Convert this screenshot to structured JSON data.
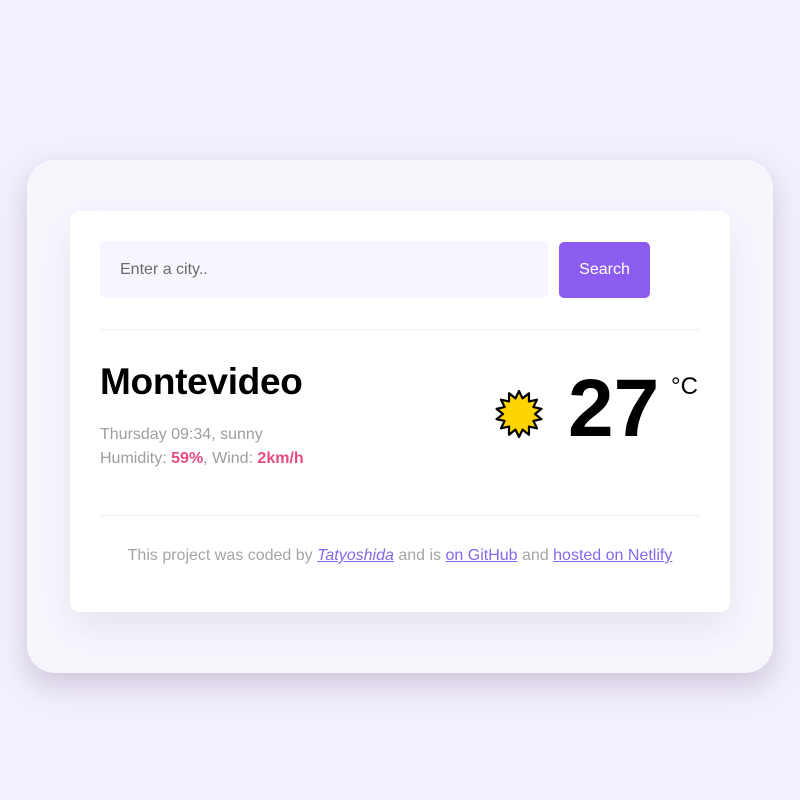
{
  "search": {
    "placeholder": "Enter a city..",
    "value": "",
    "button_label": "Search"
  },
  "weather": {
    "city": "Montevideo",
    "day_time": "Thursday 09:34",
    "condition": "sunny",
    "humidity_label": "Humidity:",
    "humidity_value": "59%",
    "wind_label": "Wind:",
    "wind_value": "2km/h",
    "icon": "sun-icon",
    "temperature": "27",
    "unit": "°C"
  },
  "footer": {
    "text_1": "This project was coded by",
    "author_link": "Tatyoshida",
    "text_2": "and is",
    "github_link": "on GitHub",
    "text_3": "and",
    "netlify_link": "hosted on Netlify"
  },
  "colors": {
    "accent": "#8c5cf0",
    "highlight": "#e64d7f",
    "link": "#8866e8",
    "sun_fill": "#ffd400",
    "background": "#f3f0fd"
  }
}
